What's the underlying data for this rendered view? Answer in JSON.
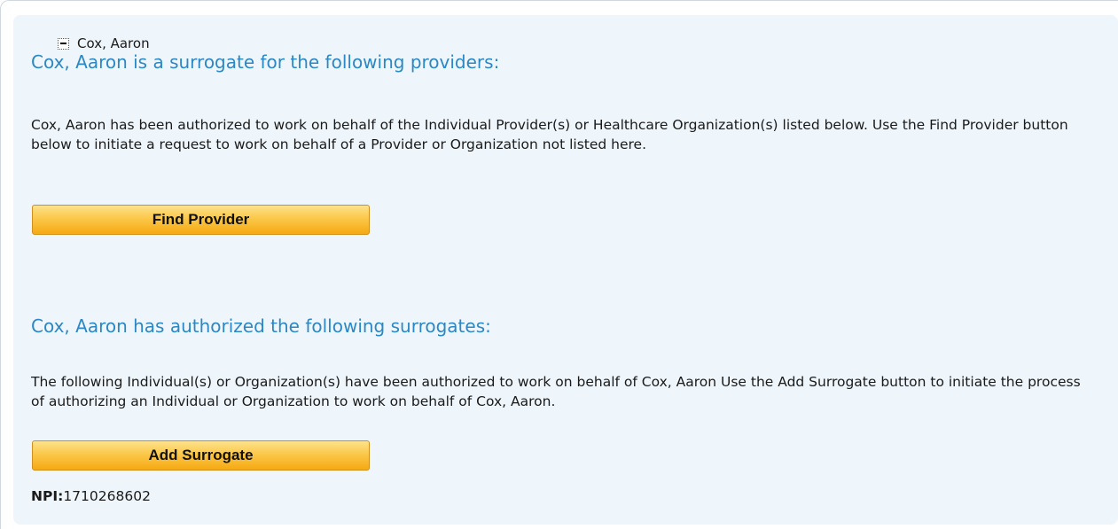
{
  "tree": {
    "node_label": "Cox, Aaron",
    "toggle_icon": "minus-icon"
  },
  "providers_section": {
    "heading": "Cox, Aaron is a surrogate for the following providers:",
    "description": "Cox, Aaron has been authorized to work on behalf of the Individual Provider(s) or Healthcare Organization(s) listed below. Use the Find Provider button below to initiate a request to work on behalf of a Provider or Organization not listed here.",
    "button_label": "Find Provider"
  },
  "surrogates_section": {
    "heading": "Cox, Aaron has authorized the following surrogates:",
    "description": "The following Individual(s) or Organization(s) have been authorized to work on behalf of Cox, Aaron Use the Add Surrogate button to initiate the process of authorizing an Individual or Organization to work on behalf of Cox, Aaron.",
    "button_label": "Add Surrogate"
  },
  "npi": {
    "label": "NPI:",
    "value": "1710268602"
  },
  "colors": {
    "heading": "#2b88c4",
    "panel_background": "#eef6fc",
    "button_gradient_top": "#fde28d",
    "button_gradient_bottom": "#f6a912"
  }
}
